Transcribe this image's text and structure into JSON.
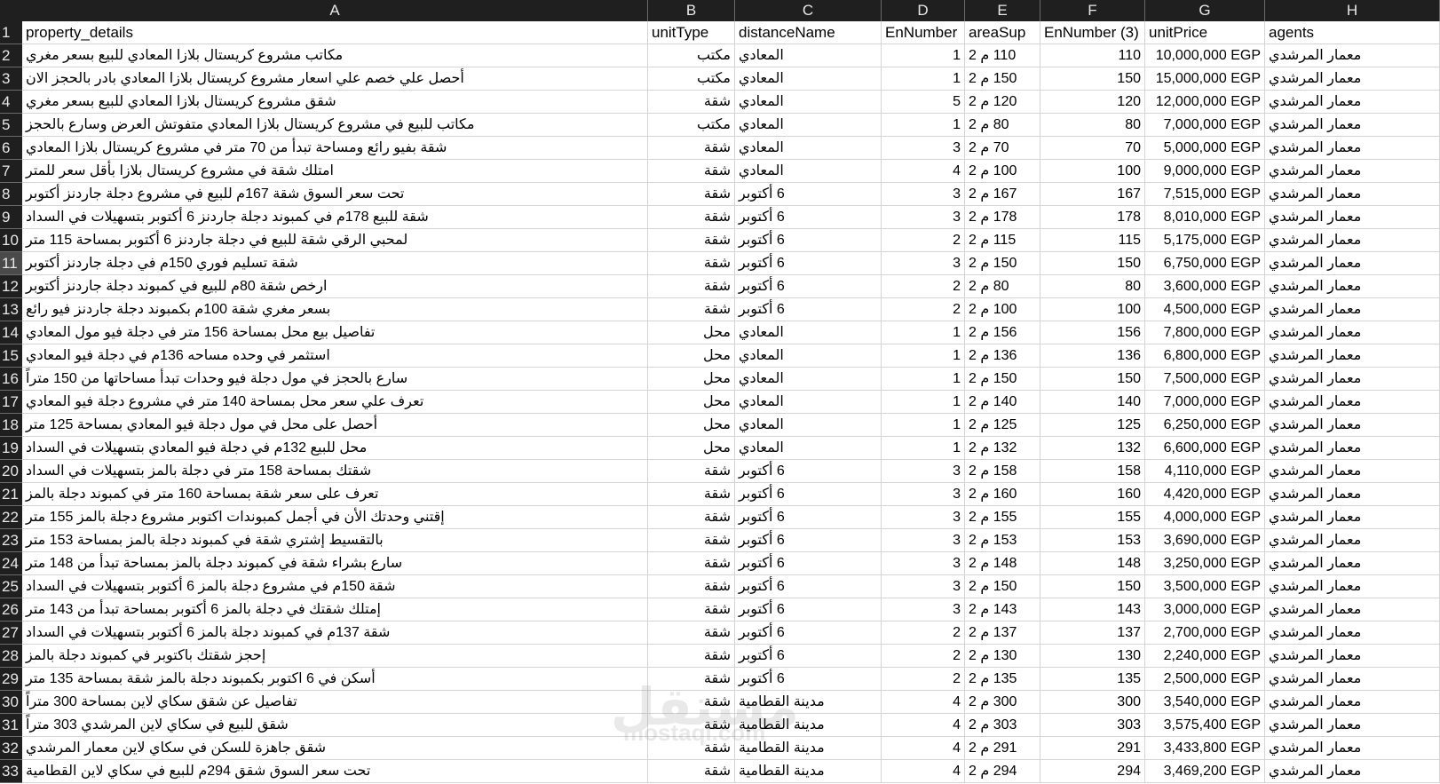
{
  "columns": [
    "A",
    "B",
    "C",
    "D",
    "E",
    "F",
    "G",
    "H"
  ],
  "header_row": [
    "property_details",
    "unitType",
    "distanceName",
    "EnNumber",
    "areaSup",
    "EnNumber (3)",
    "unitPrice",
    "agents"
  ],
  "rows": [
    [
      "مكاتب مشروع كريستال بلازا المعادي للبيع بسعر مغري",
      "مكتب",
      "المعادي",
      "1",
      "110 م 2",
      "110",
      "10,000,000 EGP",
      "معمار المرشدي"
    ],
    [
      "أحصل علي خصم علي اسعار مشروع كريستال بلازا المعادي بادر بالحجز الان",
      "مكتب",
      "المعادي",
      "1",
      "150 م 2",
      "150",
      "15,000,000 EGP",
      "معمار المرشدي"
    ],
    [
      "شقق مشروع كريستال بلازا المعادي للبيع بسعر مغري",
      "شقة",
      "المعادي",
      "5",
      "120 م 2",
      "120",
      "12,000,000 EGP",
      "معمار المرشدي"
    ],
    [
      "مكاتب للبيع في مشروع كريستال بلازا المعادي متفوتش العرض وسارع بالحجز",
      "مكتب",
      "المعادي",
      "1",
      "80 م 2",
      "80",
      "7,000,000 EGP",
      "معمار المرشدي"
    ],
    [
      "شقة بفيو رائع ومساحة تبدأ من 70 متر في مشروع كريستال بلازا المعادي",
      "شقة",
      "المعادي",
      "3",
      "70 م 2",
      "70",
      "5,000,000 EGP",
      "معمار المرشدي"
    ],
    [
      "امتلك شقة في مشروع كريستال بلازا بأقل سعر للمتر",
      "شقة",
      "المعادي",
      "4",
      "100 م 2",
      "100",
      "9,000,000 EGP",
      "معمار المرشدي"
    ],
    [
      "تحت سعر السوق شقة 167م للبيع في مشروع دجلة جاردنز أكتوبر",
      "شقة",
      "6 أكتوبر",
      "3",
      "167 م 2",
      "167",
      "7,515,000 EGP",
      "معمار المرشدي"
    ],
    [
      "شقة للبيع 178م في كمبوند دجلة جاردنز 6 أكتوبر بتسهيلات في السداد",
      "شقة",
      "6 أكتوبر",
      "3",
      "178 م 2",
      "178",
      "8,010,000 EGP",
      "معمار المرشدي"
    ],
    [
      "لمحبي الرقي شقة للبيع في دجلة جاردنز 6 أكتوبر بمساحة 115 متر",
      "شقة",
      "6 أكتوبر",
      "2",
      "115 م 2",
      "115",
      "5,175,000 EGP",
      "معمار المرشدي"
    ],
    [
      "شقة تسليم فوري 150م في دجلة جاردنز أكتوبر",
      "شقة",
      "6 أكتوبر",
      "3",
      "150 م 2",
      "150",
      "6,750,000 EGP",
      "معمار المرشدي"
    ],
    [
      "ارخص شقة 80م للبيع في كمبوند دجلة جاردنز أكتوبر",
      "شقة",
      "6 أكتوبر",
      "2",
      "80 م 2",
      "80",
      "3,600,000 EGP",
      "معمار المرشدي"
    ],
    [
      "بسعر مغري شقة 100م بكمبوند دجلة جاردنز فيو رائع",
      "شقة",
      "6 أكتوبر",
      "2",
      "100 م 2",
      "100",
      "4,500,000 EGP",
      "معمار المرشدي"
    ],
    [
      "تفاصيل بيع محل بمساحة 156 متر في دجلة فيو مول المعادي",
      "محل",
      "المعادي",
      "1",
      "156 م 2",
      "156",
      "7,800,000 EGP",
      "معمار المرشدي"
    ],
    [
      "استثمر في وحده مساحه 136م في دجلة فيو المعادي",
      "محل",
      "المعادي",
      "1",
      "136 م 2",
      "136",
      "6,800,000 EGP",
      "معمار المرشدي"
    ],
    [
      "سارع بالحجز في مول دجلة فيو وحدات تبدأ مساحاتها من 150 متراً",
      "محل",
      "المعادي",
      "1",
      "150 م 2",
      "150",
      "7,500,000 EGP",
      "معمار المرشدي"
    ],
    [
      "تعرف علي سعر محل بمساحة 140 متر في مشروع دجلة فيو المعادي",
      "محل",
      "المعادي",
      "1",
      "140 م 2",
      "140",
      "7,000,000 EGP",
      "معمار المرشدي"
    ],
    [
      "أحصل على محل في مول دجلة فيو المعادي بمساحة 125 متر",
      "محل",
      "المعادي",
      "1",
      "125 م 2",
      "125",
      "6,250,000 EGP",
      "معمار المرشدي"
    ],
    [
      "محل للبيع 132م في دجلة فيو المعادي بتسهيلات في السداد",
      "محل",
      "المعادي",
      "1",
      "132 م 2",
      "132",
      "6,600,000 EGP",
      "معمار المرشدي"
    ],
    [
      "شقتك بمساحة 158 متر في دجلة بالمز بتسهيلات في السداد",
      "شقة",
      "6 أكتوبر",
      "3",
      "158 م 2",
      "158",
      "4,110,000 EGP",
      "معمار المرشدي"
    ],
    [
      "تعرف على سعر شقة بمساحة 160 متر في كمبوند دجلة بالمز",
      "شقة",
      "6 أكتوبر",
      "3",
      "160 م 2",
      "160",
      "4,420,000 EGP",
      "معمار المرشدي"
    ],
    [
      "إقتني وحدتك الأن في أجمل كمبوندات اكتوبر مشروع دجلة بالمز 155 متر",
      "شقة",
      "6 أكتوبر",
      "3",
      "155 م 2",
      "155",
      "4,000,000 EGP",
      "معمار المرشدي"
    ],
    [
      "بالتقسيط إشتري شقة في كمبوند دجلة بالمز بمساحة 153 متر",
      "شقة",
      "6 أكتوبر",
      "3",
      "153 م 2",
      "153",
      "3,690,000 EGP",
      "معمار المرشدي"
    ],
    [
      "سارع بشراء شقة في كمبوند دجلة بالمز بمساحة تبدأ من 148 متر",
      "شقة",
      "6 أكتوبر",
      "3",
      "148 م 2",
      "148",
      "3,250,000 EGP",
      "معمار المرشدي"
    ],
    [
      "شقة 150م في مشروع دجلة بالمز 6 أكتوبر بتسهيلات في السداد",
      "شقة",
      "6 أكتوبر",
      "3",
      "150 م 2",
      "150",
      "3,500,000 EGP",
      "معمار المرشدي"
    ],
    [
      "إمتلك شقتك في دجلة بالمز 6 أكتوبر بمساحة تبدأ من 143 متر",
      "شقة",
      "6 أكتوبر",
      "3",
      "143 م 2",
      "143",
      "3,000,000 EGP",
      "معمار المرشدي"
    ],
    [
      "شقة 137م في كمبوند دجلة بالمز 6 أكتوبر بتسهيلات في السداد",
      "شقة",
      "6 أكتوبر",
      "2",
      "137 م 2",
      "137",
      "2,700,000 EGP",
      "معمار المرشدي"
    ],
    [
      "إحجز شقتك باكتوبر في كمبوند دجلة بالمز",
      "شقة",
      "6 أكتوبر",
      "2",
      "130 م 2",
      "130",
      "2,240,000 EGP",
      "معمار المرشدي"
    ],
    [
      "أسكن في 6 اكتوبر بكمبوند دجلة بالمز شقة بمساحة 135 متر",
      "شقة",
      "6 أكتوبر",
      "2",
      "135 م 2",
      "135",
      "2,500,000 EGP",
      "معمار المرشدي"
    ],
    [
      "تفاصيل عن شقق سكاي لاين بمساحة 300 متراً",
      "شقة",
      "مدينة القطامية",
      "4",
      "300 م 2",
      "300",
      "3,540,000 EGP",
      "معمار المرشدي"
    ],
    [
      "شقق للبيع في سكاي لاين المرشدي 303 متراً",
      "شقة",
      "مدينة القطامية",
      "4",
      "303 م 2",
      "303",
      "3,575,400 EGP",
      "معمار المرشدي"
    ],
    [
      "شقق جاهزة للسكن في سكاي لاين معمار المرشدي",
      "شقة",
      "مدينة القطامية",
      "4",
      "291 م 2",
      "291",
      "3,433,800 EGP",
      "معمار المرشدي"
    ],
    [
      "تحت سعر السوق شقق 294م للبيع في سكاي لاين القطامية",
      "شقة",
      "مدينة القطامية",
      "4",
      "294 م 2",
      "294",
      "3,469,200 EGP",
      "معمار المرشدي"
    ]
  ],
  "watermark": {
    "line1": "مستقل",
    "line2": "mostaql.com"
  }
}
